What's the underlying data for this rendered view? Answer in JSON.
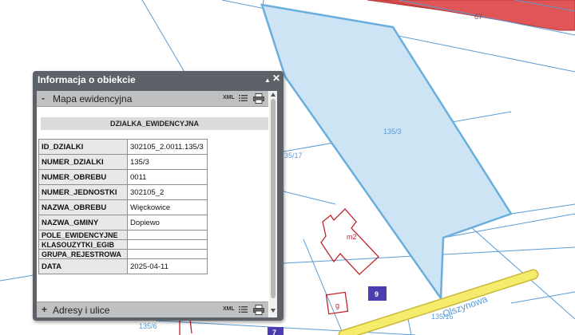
{
  "map": {
    "parcel_labels": {
      "main": "135/3",
      "left": "35/17",
      "top_right": "67",
      "bottom_left": "135/6",
      "bottom_right": "135/16"
    },
    "building_labels": {
      "m2": "m2",
      "g": "g",
      "badge9": "9",
      "badge7": "7"
    },
    "street_name": "Olszynowa",
    "colors": {
      "parcel_lines": "#5b9bd5",
      "selected_fill": "#cce4f4",
      "selected_stroke": "#6aaedc",
      "road": "#f4ec6a",
      "road_edge": "#c9b83a",
      "building": "#c0242b",
      "red_road": "#e05555",
      "badge": "#4b3db0"
    }
  },
  "info_window": {
    "title": "Informacja o obiekcie",
    "minimize_symbol": "▲",
    "close_symbol": "✕",
    "sections": [
      {
        "toggle": "-",
        "label": "Mapa ewidencyjna",
        "xml": "XML"
      },
      {
        "toggle": "+",
        "label": "Adresy i ulice",
        "xml": "XML"
      }
    ],
    "layer_title": "DZIALKA_EWIDENCYJNA",
    "attributes": [
      {
        "key": "ID_DZIALKI",
        "value": "302105_2.0011.135/3"
      },
      {
        "key": "NUMER_DZIALKI",
        "value": "135/3"
      },
      {
        "key": "NUMER_OBREBU",
        "value": "0011"
      },
      {
        "key": "NUMER_JEDNOSTKI",
        "value": "302105_2"
      },
      {
        "key": "NAZWA_OBREBU",
        "value": "Więckowice"
      },
      {
        "key": "NAZWA_GMINY",
        "value": "Dopiewo"
      },
      {
        "key": "POLE_EWIDENCYJNE",
        "value": ""
      },
      {
        "key": "KLASOUZYTKI_EGIB",
        "value": ""
      },
      {
        "key": "GRUPA_REJESTROWA",
        "value": ""
      },
      {
        "key": "DATA",
        "value": "2025-04-11"
      }
    ]
  }
}
